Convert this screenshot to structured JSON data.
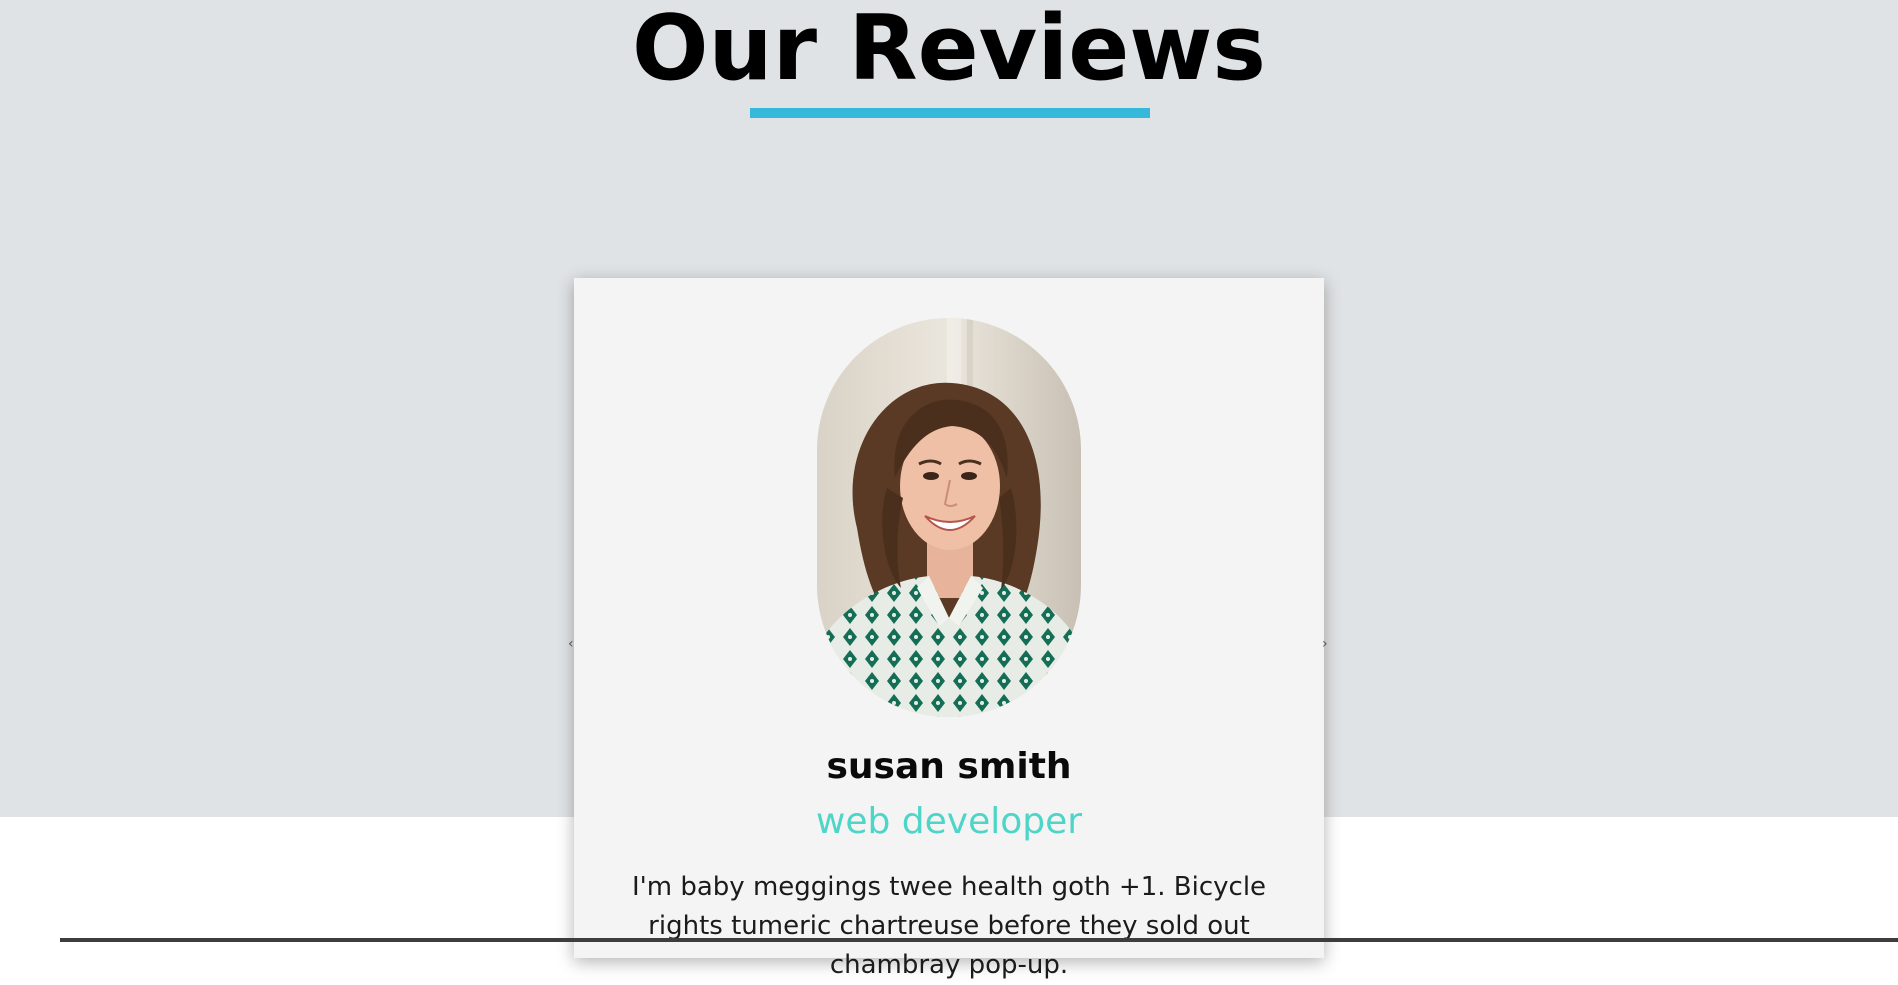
{
  "section": {
    "title": "Our Reviews",
    "accent_color": "#36b8da",
    "background_color": "#e0e3e5"
  },
  "review": {
    "name": "susan smith",
    "job": "web developer",
    "job_color": "#4dd6c8",
    "text": "I'm baby meggings twee health goth +1. Bicycle rights tumeric chartreuse before they sold out chambray pop-up."
  },
  "controls": {
    "prev_icon": "chevron-left-icon",
    "prev_glyph": "‹",
    "next_icon": "chevron-right-icon",
    "next_glyph": "›"
  }
}
